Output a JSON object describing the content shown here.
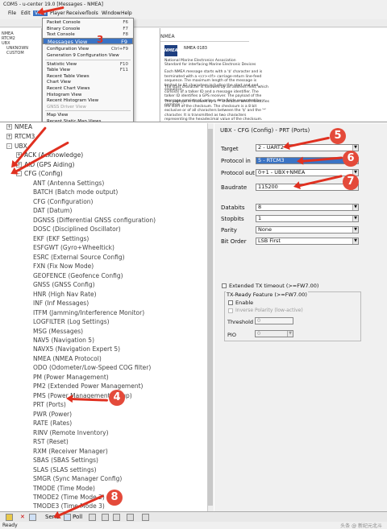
{
  "window": {
    "title": "COM5 - u-center 19.0 [Messages - NMEA]"
  },
  "menubar": [
    "File",
    "Edit",
    "View",
    "Player",
    "Receiver",
    "Tools",
    "Window",
    "Help"
  ],
  "menu": {
    "items": [
      {
        "label": "Packet Console",
        "key": "F6"
      },
      {
        "label": "Binary Console",
        "key": "F7"
      },
      {
        "label": "Text Console",
        "key": "F8"
      },
      {
        "label": "Messages View",
        "key": "F9",
        "selected": true
      },
      {
        "label": "Configuration View",
        "key": "Ctrl+F9"
      },
      {
        "label": "Generation 9 Configuration View",
        "key": ""
      },
      {
        "label": "Statistic View",
        "key": "F10"
      },
      {
        "label": "Table View",
        "key": "F11"
      },
      {
        "label": "Recent Table Views",
        "key": ""
      },
      {
        "label": "Chart View",
        "key": ""
      },
      {
        "label": "Recent Chart Views",
        "key": ""
      },
      {
        "label": "Histogram View",
        "key": ""
      },
      {
        "label": "Recent Histogram View",
        "key": ""
      },
      {
        "label": "GNSS Driver View",
        "key": "",
        "disabled": true
      },
      {
        "label": "Map View",
        "key": ""
      },
      {
        "label": "Recent Static Map Views",
        "key": ""
      }
    ]
  },
  "leftmini": [
    "NMEA",
    "RTCM2",
    "UBX",
    "UNKNOWN",
    "CUSTOM"
  ],
  "nmea_doc": {
    "header": "NMEA",
    "logo": "NMEA",
    "standard": "NMEA 0183",
    "org": "National Marine Electronics Association",
    "desc": "Standard for interfacing Marine Electronic Devices",
    "p1": "Each NMEA message starts with a '$' character and is terminated with a <cr><lf> carriage-return line-feed sequence. The maximum length of the message is limited to 82 characters including the start and end sequence.",
    "p2": "The start character is followed by an address field, which consists of a talker ID and a message identifier. The talker ID identifies a GPS receiver. The payload of the message consists of various data fields separated by commas ','.",
    "p3": "The payload is followed by a '*' character which identifies the start of the checksum. The checksum is a 8 bit exclusive or of all characters between the '$' and the '*' character. It is transmitted as two characters representing the hexadecimal value of the checksum."
  },
  "tree": {
    "roots": [
      "NMEA",
      "RTCM3",
      "UBX"
    ],
    "ubx_children": [
      "ACK (Acknowledge)",
      "AID (GPS Aiding)",
      "CFG (Config)"
    ],
    "cfg_items": [
      "ANT (Antenna Settings)",
      "BATCH (Batch mode output)",
      "CFG (Configuration)",
      "DAT (Datum)",
      "DGNSS (Differential GNSS configuration)",
      "DOSC (Disciplined Oscillator)",
      "EKF (EKF Settings)",
      "ESFGWT (Gyro+Wheeltick)",
      "ESRC (External Source Config)",
      "FXN (Fix Now Mode)",
      "GEOFENCE (Geofence Config)",
      "GNSS (GNSS Config)",
      "HNR (High Nav Rate)",
      "INF (Inf Messages)",
      "ITFM (Jamming/Interference Monitor)",
      "LOGFILTER (Log Settings)",
      "MSG (Messages)",
      "NAV5 (Navigation 5)",
      "NAVX5 (Navigation Expert 5)",
      "NMEA (NMEA Protocol)",
      "ODO (Odometer/Low-Speed COG filter)",
      "PM (Power Management)",
      "PM2 (Extended Power Management)",
      "PMS (Power Management Setup)",
      "PRT (Ports)",
      "PWR (Power)",
      "RATE (Rates)",
      "RINV (Remote Inventory)",
      "RST (Reset)",
      "RXM (Receiver Manager)",
      "SBAS (SBAS Settings)",
      "SLAS (SLAS settings)",
      "SMGR (Sync Manager Config)",
      "TMODE (Time Mode)",
      "TMODE2 (Time Mode 2)",
      "TMODE3 (Time Mode 3)",
      "TP (Timepulse)"
    ]
  },
  "form": {
    "title": "UBX - CFG (Config) - PRT (Ports)",
    "target_label": "Target",
    "target_value": "2 - UART2",
    "protin_label": "Protocol in",
    "protin_value": "5 - RTCM3",
    "protout_label": "Protocol out",
    "protout_value": "0+1 - UBX+NMEA",
    "baud_label": "Baudrate",
    "baud_value": "115200",
    "databits_label": "Databits",
    "databits_value": "8",
    "stopbits_label": "Stopbits",
    "stopbits_value": "1",
    "parity_label": "Parity",
    "parity_value": "None",
    "bitorder_label": "Bit Order",
    "bitorder_value": "LSB First",
    "ext_tx_label": "Extended TX timeout (>=FW7.00)",
    "txready_label": "TX-Ready Feature (>=FW7.00)",
    "enable_label": "Enable",
    "inverse_label": "Inverse Polarity (low-active)",
    "threshold_label": "Threshold",
    "threshold_value": "0",
    "pio_label": "PIO",
    "pio_value": "0"
  },
  "toolbar": {
    "send": "Send",
    "poll": "Poll"
  },
  "status": "Ready",
  "badges": [
    "3",
    "4",
    "5",
    "6",
    "7",
    "8"
  ],
  "watermark": "头条 @ 新纪元北斗",
  "accent": "#e44a3a"
}
